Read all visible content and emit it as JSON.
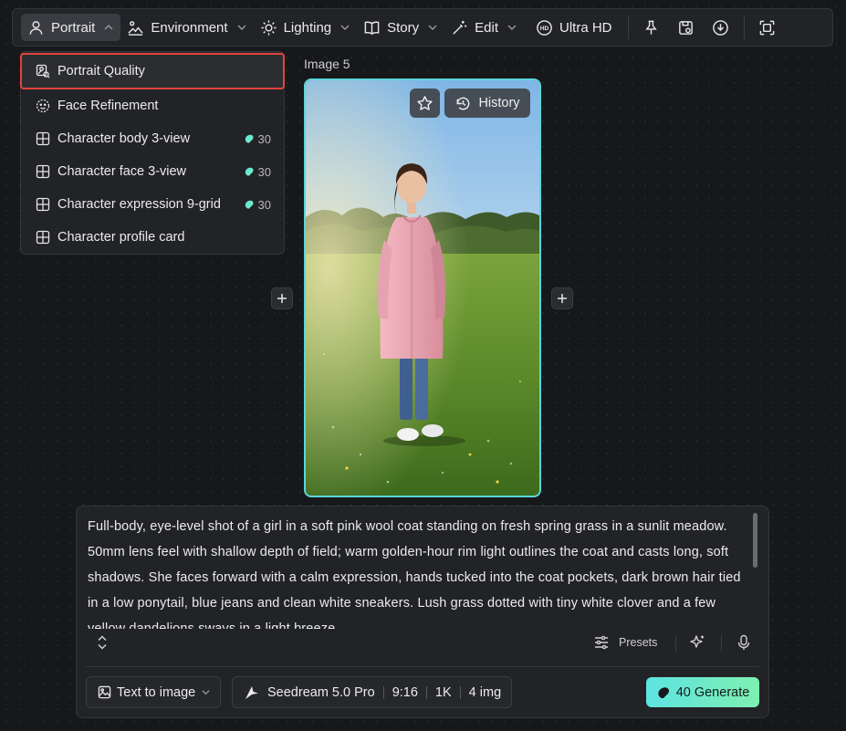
{
  "toolbar": {
    "items": [
      {
        "label": "Portrait",
        "icon": "user-icon",
        "active": true
      },
      {
        "label": "Environment",
        "icon": "landscape-icon"
      },
      {
        "label": "Lighting",
        "icon": "sun-icon"
      },
      {
        "label": "Story",
        "icon": "book-icon"
      },
      {
        "label": "Edit",
        "icon": "magic-wand-icon"
      },
      {
        "label": "Ultra HD",
        "icon": "hd-icon"
      }
    ],
    "icons": [
      "pin-icon",
      "save-icon",
      "download-icon",
      "focus-icon"
    ]
  },
  "dropdown": {
    "items": [
      {
        "label": "Portrait Quality",
        "icon": "portrait-quality-icon",
        "selected": true
      },
      {
        "label": "Face Refinement",
        "icon": "face-icon"
      },
      {
        "label": "Character body 3-view",
        "icon": "grid-icon",
        "cost": "30"
      },
      {
        "label": "Character face 3-view",
        "icon": "grid-icon",
        "cost": "30"
      },
      {
        "label": "Character expression 9-grid",
        "icon": "grid-icon",
        "cost": "30"
      },
      {
        "label": "Character profile card",
        "icon": "grid-icon"
      }
    ]
  },
  "canvas": {
    "image_label": "Image 5",
    "history_label": "History"
  },
  "prompt": {
    "text": "Full-body, eye-level shot of a girl in a soft pink wool coat standing on fresh spring grass in a sunlit meadow. 50mm lens feel with shallow depth of field; warm golden-hour rim light outlines the coat and casts long, soft shadows. She faces forward with a calm expression, hands tucked into the coat pockets, dark brown hair tied in a low ponytail, blue jeans and clean white sneakers. Lush grass dotted with tiny white clover and a few yellow dandelions sways in a light breeze."
  },
  "controls": {
    "presets_label": "Presets",
    "mode_label": "Text to image",
    "model_label": "Seedream 5.0 Pro",
    "ratio": "9:16",
    "resolution": "1K",
    "count": "4 img",
    "generate_label": "40 Generate"
  },
  "colors": {
    "accent_cyan": "#5bd6d9",
    "generate_start": "#5de3e1",
    "generate_end": "#7ef0b0",
    "selection_red": "#e0453d",
    "background": "#17181b"
  }
}
